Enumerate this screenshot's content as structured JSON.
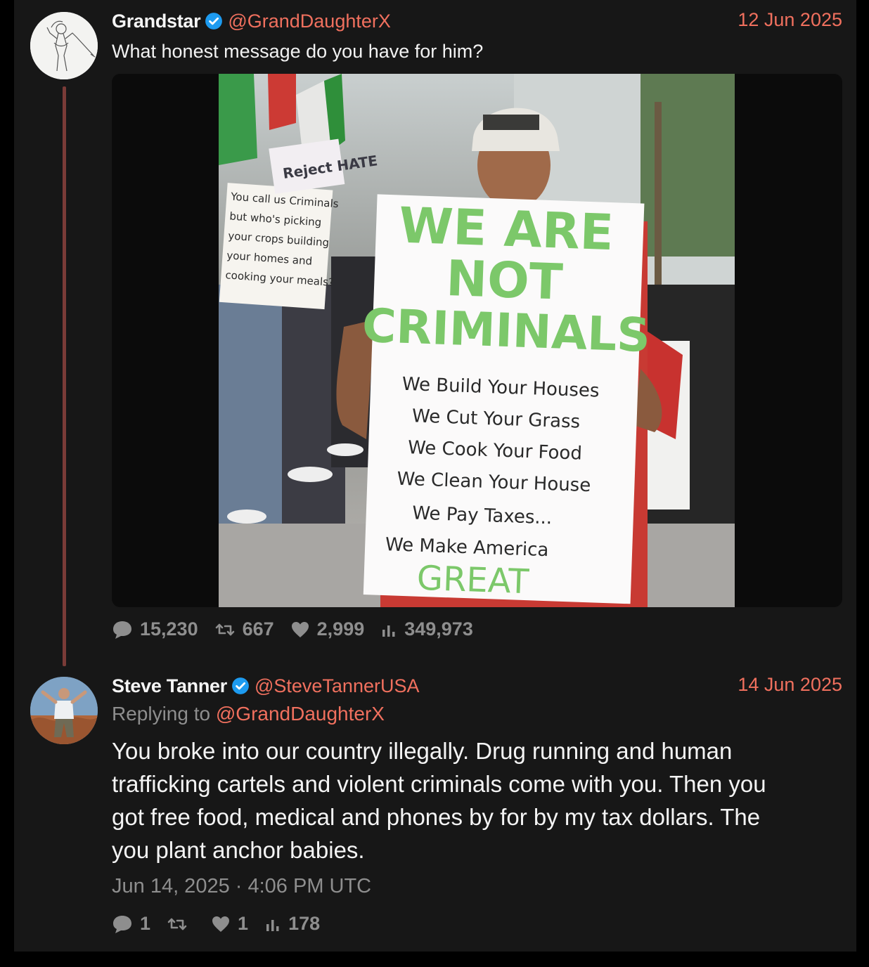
{
  "tweet1": {
    "author_name": "Grandstar",
    "handle": "@GrandDaughterX",
    "date": "12 Jun 2025",
    "text": "What honest message do you have for him?",
    "image": {
      "sign_line1": "WE ARE",
      "sign_line2": "NOT",
      "sign_line3": "CRIMINALS",
      "sign_list": [
        "We Build Your Houses",
        "We Cut Your Grass",
        "We Cook Your Food",
        "We Clean Your House",
        "We Pay Taxes...",
        "We Make America"
      ],
      "sign_last": "GREAT",
      "left_sign_lines": [
        "You call us Criminals",
        "but who's picking",
        "your crops building",
        "your homes and",
        "cooking your meals?"
      ],
      "small_sign": "Reject HATE"
    },
    "stats": {
      "replies": "15,230",
      "retweets": "667",
      "likes": "2,999",
      "views": "349,973"
    }
  },
  "tweet2": {
    "author_name": "Steve Tanner",
    "handle": "@SteveTannerUSA",
    "date": "14 Jun 2025",
    "replying_prefix": "Replying to",
    "replying_handle": "@GrandDaughterX",
    "text": "You broke into our country illegally. Drug running and human\ntrafficking cartels and violent criminals come with you.  Then you\ngot free food, medical and phones by for by my tax dollars.  The\nyou plant anchor babies.",
    "timestamp": "Jun 14, 2025 · 4:06 PM UTC",
    "stats": {
      "replies": "1",
      "retweets": "",
      "likes": "1",
      "views": "178"
    }
  },
  "colors": {
    "accent": "#f0705e",
    "verified": "#1d9bf0",
    "muted": "#8e8e8e",
    "panel": "#171717",
    "thread_line": "#7a3b37",
    "sign_green": "#7cc86a"
  },
  "icons": [
    "verified-badge-icon",
    "reply-icon",
    "retweet-icon",
    "like-icon",
    "views-icon"
  ]
}
